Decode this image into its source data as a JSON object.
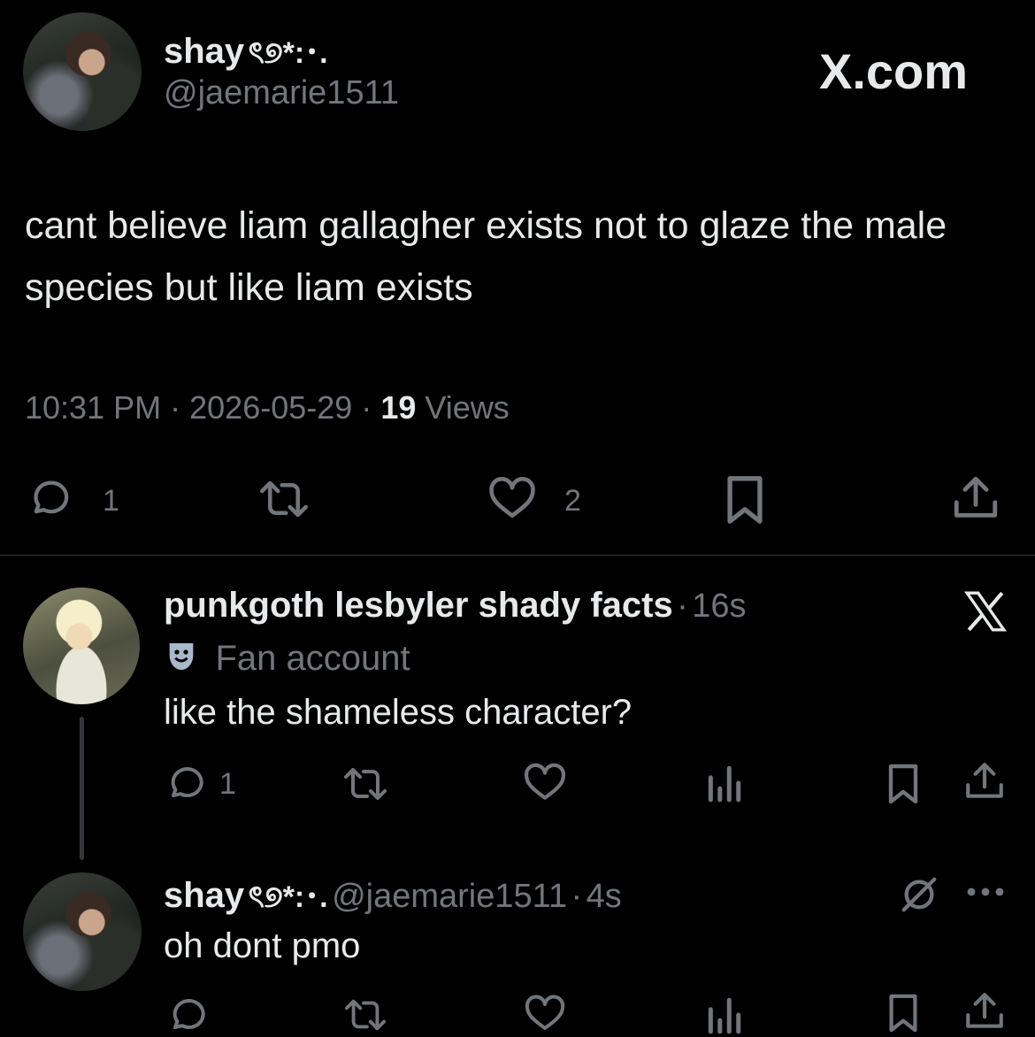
{
  "main_tweet": {
    "display_name": "shay",
    "name_emoji": "ৎ୭*:･.",
    "handle": "@jaemarie1511",
    "brand": "X.com",
    "text": "cant believe liam gallagher exists not to glaze the male species but like liam exists",
    "time": "10:31 PM",
    "date": "2026-05-29",
    "views_count": "19",
    "views_label": "Views",
    "sep": "·",
    "replies": "1",
    "likes": "2"
  },
  "reply1": {
    "display_name": "punkgoth lesbyler shady facts",
    "sep": "·",
    "age": "16s",
    "badge": "Fan account",
    "badge_icon": "theater-mask-icon",
    "text": "like the shameless character?",
    "replies": "1"
  },
  "reply2": {
    "display_name": "shay",
    "name_emoji": "ৎ୭*:･.",
    "handle": "@jaemarie1511",
    "sep": "·",
    "age": "4s",
    "text": "oh dont pmo"
  },
  "colors": {
    "background": "#000000",
    "text": "#e7e9ea",
    "muted": "#71767b",
    "divider": "#2f3336"
  }
}
